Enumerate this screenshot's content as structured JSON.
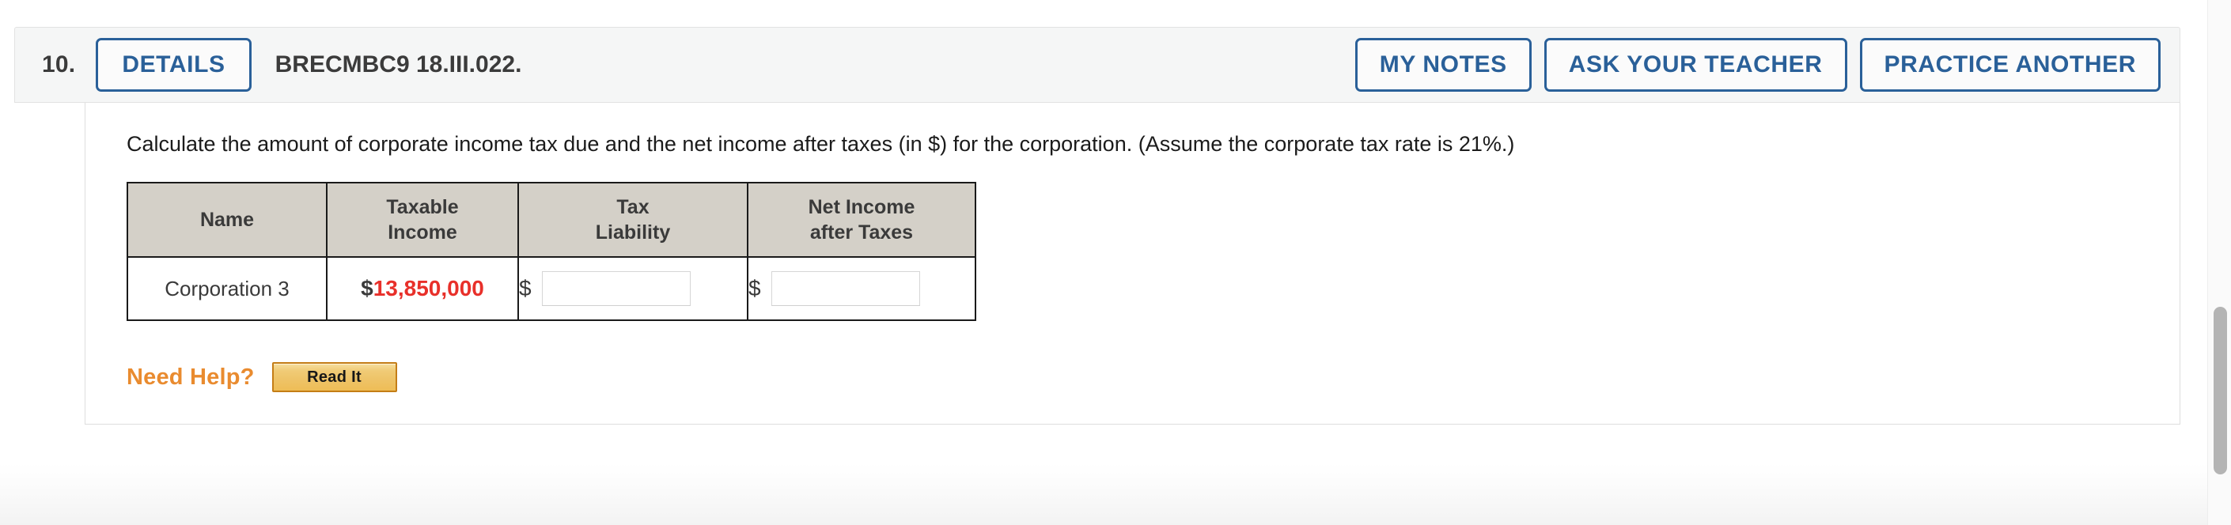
{
  "question": {
    "number": "10.",
    "details_label": "DETAILS",
    "title": "BRECMBC9 18.III.022.",
    "actions": [
      {
        "label": "MY NOTES",
        "name": "my-notes-button"
      },
      {
        "label": "ASK YOUR TEACHER",
        "name": "ask-your-teacher-button"
      },
      {
        "label": "PRACTICE ANOTHER",
        "name": "practice-another-button"
      }
    ],
    "prompt": "Calculate the amount of corporate income tax due and the net income after taxes (in $) for the corporation. (Assume the corporate tax rate is 21%.)"
  },
  "table": {
    "headers": [
      "Name",
      "Taxable Income",
      "Tax Liability",
      "Net Income after Taxes"
    ],
    "header_lines": [
      [
        "Name"
      ],
      [
        "Taxable",
        "Income"
      ],
      [
        "Tax",
        "Liability"
      ],
      [
        "Net Income",
        "after Taxes"
      ]
    ],
    "rows": [
      {
        "name": "Corporation 3",
        "taxable_income_currency": "$",
        "taxable_income_value": "13,850,000",
        "tax_liability_currency": "$",
        "tax_liability_value": "",
        "tax_liability_placeholder": "",
        "net_income_currency": "$",
        "net_income_value": "",
        "net_income_placeholder": ""
      }
    ]
  },
  "help": {
    "label": "Need Help?",
    "read_it_label": "Read It"
  },
  "colors": {
    "accent_blue": "#2a6099",
    "amount_red": "#e8302a",
    "help_orange": "#e98b2f",
    "table_header_bg": "#d4d0c8",
    "header_bar_bg": "#f5f6f6",
    "read_it_border": "#c47d16"
  }
}
